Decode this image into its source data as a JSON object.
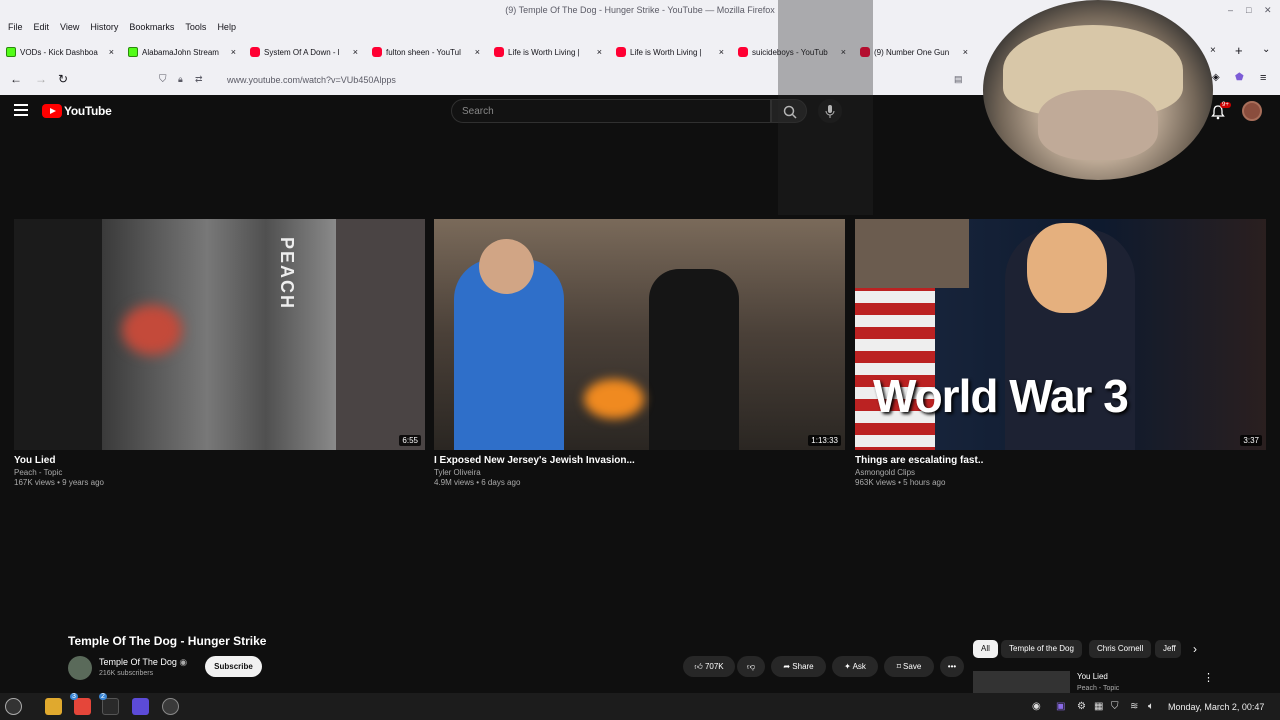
{
  "browser": {
    "window_title": "(9) Temple Of The Dog - Hunger Strike - YouTube — Mozilla Firefox",
    "menu": [
      "File",
      "Edit",
      "View",
      "History",
      "Bookmarks",
      "Tools",
      "Help"
    ],
    "tabs": [
      {
        "label": "VODs - Kick Dashboa",
        "favicon": "kick"
      },
      {
        "label": "AlabamaJohn Stream",
        "favicon": "kick"
      },
      {
        "label": "System Of A Down - l",
        "favicon": "yt"
      },
      {
        "label": "fulton sheen - YouTul",
        "favicon": "yt"
      },
      {
        "label": "Life is Worth Living | ",
        "favicon": "yt"
      },
      {
        "label": "Life is Worth Living | ",
        "favicon": "yt"
      },
      {
        "label": "suicideboys - YouTub",
        "favicon": "yt"
      },
      {
        "label": "(9) Number One Gun",
        "favicon": "yt"
      }
    ],
    "tab_close": "×",
    "new_tab": "+",
    "url": "www.youtube.com/watch?v=VUb450Alpps"
  },
  "youtube": {
    "logo_text": "YouTube",
    "search_placeholder": "Search",
    "notification_count": "9+",
    "end_screen": [
      {
        "title": "You Lied",
        "channel": "Peach - Topic",
        "meta": "167K views • 9 years ago",
        "duration": "6:55",
        "thumb_text": "PEACH"
      },
      {
        "title": "I Exposed New Jersey's Jewish Invasion...",
        "channel": "Tyler Oliveira",
        "meta": "4.9M views • 6 days ago",
        "duration": "1:13:33"
      },
      {
        "title": "Things are escalating fast..",
        "channel": "Asmongold Clips",
        "meta": "963K views • 5 hours ago",
        "duration": "3:37",
        "thumb_text": "World War 3"
      }
    ],
    "video": {
      "title": "Temple Of The Dog - Hunger Strike",
      "channel": "Temple Of The Dog",
      "subscribers": "216K subscribers",
      "subscribe_label": "Subscribe",
      "likes": "707K",
      "share_label": "Share",
      "ask_label": "Ask",
      "save_label": "Save",
      "more_label": "•••"
    },
    "chips": [
      "All",
      "Temple of the Dog",
      "Chris Cornell",
      "Jeff"
    ],
    "recommended": {
      "title": "You Lied",
      "channel": "Peach - Topic"
    }
  },
  "taskbar": {
    "clock": "Monday, March  2, 00:47",
    "badge_a": "3",
    "badge_b": "2"
  }
}
